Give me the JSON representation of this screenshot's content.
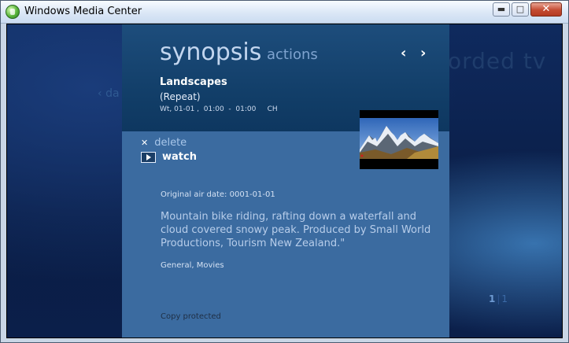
{
  "window": {
    "title": "Windows Media Center"
  },
  "background": {
    "section_title": "orded tv",
    "back_label": "da",
    "page_current": "1",
    "page_total": "1"
  },
  "panel": {
    "tabs": {
      "active": "synopsis",
      "inactive": "actions"
    },
    "nav": {
      "prev": "‹",
      "next": "›"
    },
    "program": {
      "title": "Landscapes",
      "repeat": "(Repeat)",
      "schedule": "Wt, 01-01 ,  01:00  -  01:00     CH"
    },
    "actions": {
      "delete_label": "delete",
      "watch_label": "watch"
    },
    "details": {
      "original_air_date": "Original air date: 0001-01-01",
      "description": "Mountain bike riding, rafting down a waterfall and cloud covered snowy peak. Produced by Small World Productions, Tourism New Zealand.\"",
      "genre": "General, Movies",
      "copy_status": "Copy protected"
    }
  },
  "icons": {
    "app_logo": "windows-media-center-logo",
    "back": "chevron-left-icon",
    "prev": "chevron-left-icon",
    "next": "chevron-right-icon",
    "delete": "close-icon",
    "watch": "play-icon"
  },
  "colors": {
    "panel": "#3b6ba0",
    "header": "#113d67",
    "content_bg": "#0f2a5e"
  }
}
